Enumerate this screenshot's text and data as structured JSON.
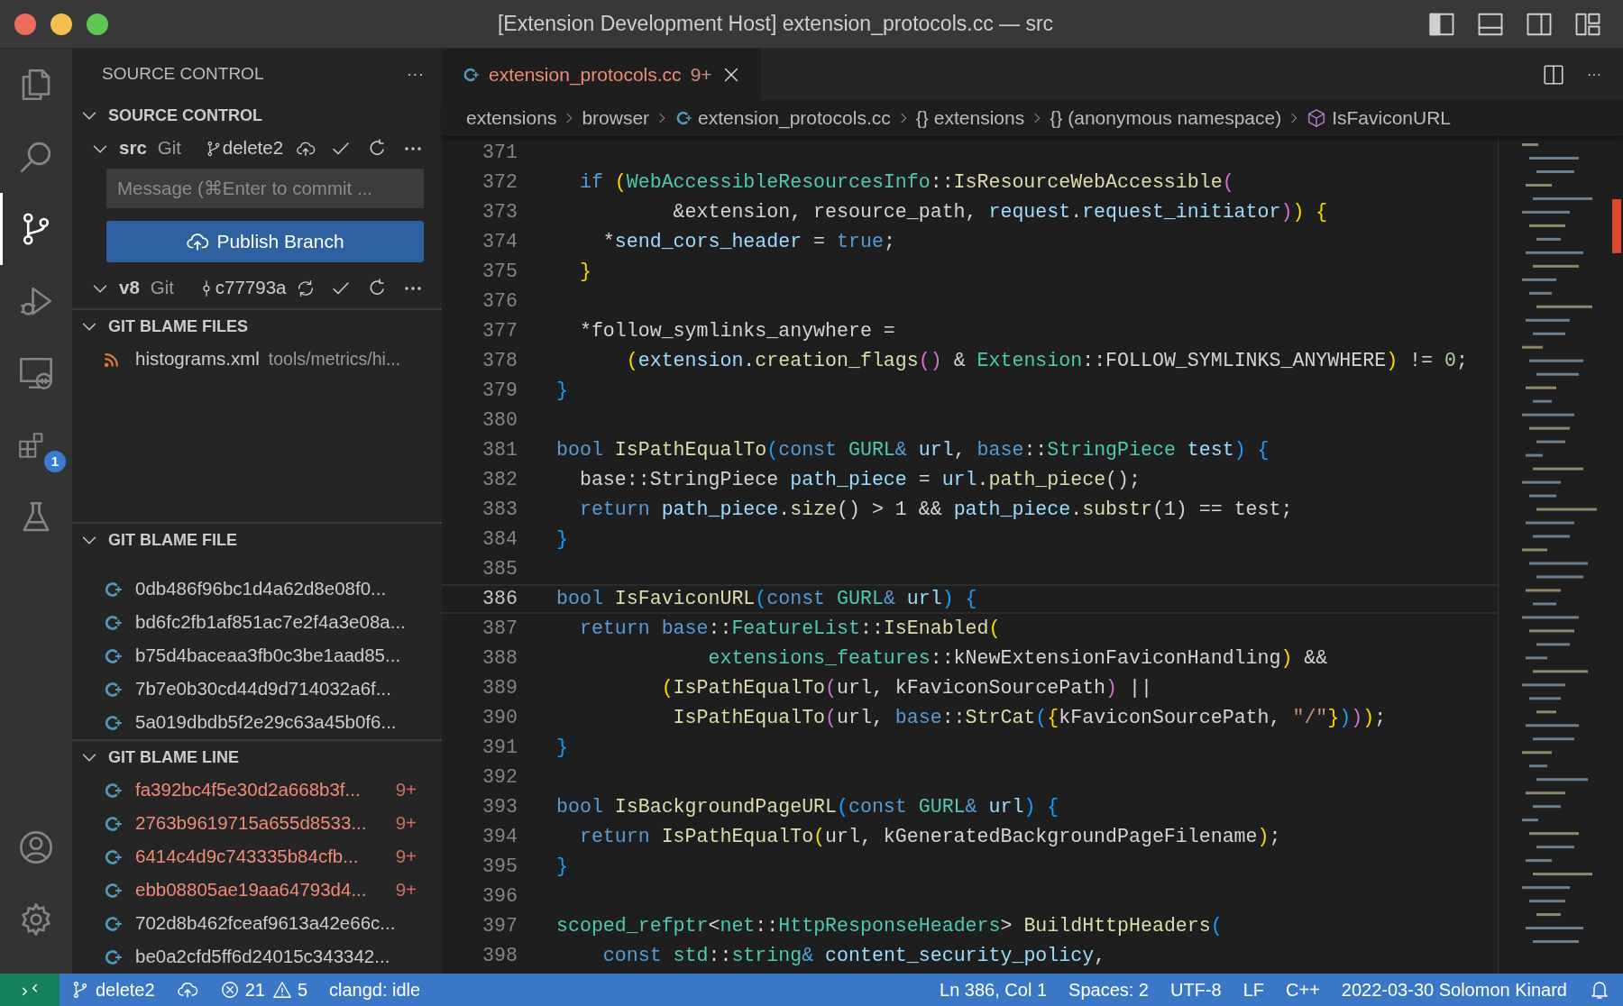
{
  "window": {
    "title": "[Extension Development Host] extension_protocols.cc — src",
    "layout_buttons": [
      {
        "kind": "sidebar"
      },
      {
        "kind": "panel"
      },
      {
        "kind": "secondary"
      },
      {
        "kind": "custom"
      }
    ]
  },
  "activity_bar": [
    {
      "kind": "explorer",
      "selected": false
    },
    {
      "kind": "search",
      "selected": false
    },
    {
      "kind": "scm",
      "selected": true
    },
    {
      "kind": "debug",
      "selected": false
    },
    {
      "kind": "remote",
      "selected": false
    },
    {
      "kind": "extensions",
      "selected": false,
      "badge": "1"
    },
    {
      "kind": "testing",
      "selected": false
    },
    {
      "kind": "accounts",
      "selected": false
    },
    {
      "kind": "settings",
      "selected": false
    }
  ],
  "sidebar": {
    "title": "SOURCE CONTROL",
    "more": "···",
    "sections": [
      {
        "kind": "repositories",
        "title": "SOURCE CONTROL",
        "expanded": true,
        "repositories": [
          {
            "name": "src",
            "provider": "Git",
            "ref": {
              "kind": "branch",
              "text": "delete2"
            },
            "sync": {
              "kind": "publish"
            },
            "expanded": true,
            "message": {
              "placeholder": "Message (⌘Enter to commit ..."
            },
            "action": "Publish Branch"
          },
          {
            "name": "v8",
            "provider": "Git",
            "ref": {
              "kind": "commit",
              "text": "c77793a"
            },
            "sync": {
              "kind": "sync"
            },
            "expanded": true
          }
        ]
      },
      {
        "kind": "files",
        "title": "GIT BLAME FILES",
        "expanded": true,
        "items": [
          {
            "name": "histograms.xml",
            "path": "tools/metrics/hi..."
          }
        ]
      },
      {
        "kind": "commits",
        "title": "GIT BLAME FILE",
        "expanded": true,
        "items": [
          {
            "hash": "0db486f96bc1d4a62d8e08f0...",
            "error": false
          },
          {
            "hash": "bd6fc2fb1af851ac7e2f4a3e08a...",
            "error": false
          },
          {
            "hash": "b75d4baceaa3fb0c3be1aad85...",
            "error": false
          },
          {
            "hash": "7b7e0b30cd44d9d714032a6f...",
            "error": false
          },
          {
            "hash": "5a019dbdb5f2e29c63a45b0f6...",
            "error": false
          }
        ]
      },
      {
        "kind": "commits",
        "title": "GIT BLAME LINE",
        "expanded": true,
        "items": [
          {
            "hash": "fa392bc4f5e30d2a668b3f...",
            "error": true,
            "problems": "9+"
          },
          {
            "hash": "2763b9619715a655d8533...",
            "error": true,
            "problems": "9+"
          },
          {
            "hash": "6414c4d9c743335b84cfb...",
            "error": true,
            "problems": "9+"
          },
          {
            "hash": "ebb08805ae19aa64793d4...",
            "error": true,
            "problems": "9+"
          },
          {
            "hash": "702d8b462fceaf9613a42e66c...",
            "error": false
          },
          {
            "hash": "be0a2cfd5ff6d24015c343342...",
            "error": false
          }
        ]
      }
    ]
  },
  "editor": {
    "tabs": [
      {
        "name": "extension_protocols.cc",
        "problems": "9+",
        "error": true,
        "selected": true
      }
    ],
    "more": "···",
    "breadcrumbs": [
      {
        "kind": "folder",
        "label": "extensions"
      },
      {
        "kind": "folder",
        "label": "browser"
      },
      {
        "kind": "file",
        "label": "extension_protocols.cc"
      },
      {
        "kind": "namespace",
        "symbol": "{}",
        "label": "extensions"
      },
      {
        "kind": "namespace",
        "symbol": "{}",
        "label": "(anonymous namespace)"
      },
      {
        "kind": "method",
        "label": "IsFaviconURL"
      }
    ],
    "lines": [
      {
        "number": "371",
        "current": false
      },
      {
        "number": "372",
        "current": false,
        "tokens": [
          {
            "kind": "keyword",
            "text": "  if"
          },
          {
            "kind": "bracket1",
            "text": " ("
          },
          {
            "kind": "type",
            "text": "WebAccessibleResourcesInfo"
          },
          {
            "kind": "plain",
            "text": "::"
          },
          {
            "kind": "function",
            "text": "IsResourceWebAccessible"
          },
          {
            "kind": "bracket2",
            "text": "("
          }
        ]
      },
      {
        "number": "373",
        "current": false,
        "tokens": [
          {
            "kind": "plain",
            "text": "          &extension, resource_path, "
          },
          {
            "kind": "variable",
            "text": "request"
          },
          {
            "kind": "plain",
            "text": "."
          },
          {
            "kind": "variable",
            "text": "request_initiator"
          },
          {
            "kind": "bracket2",
            "text": ")"
          },
          {
            "kind": "bracket1",
            "text": ")"
          },
          {
            "kind": "bracket1",
            "text": " {"
          }
        ]
      },
      {
        "number": "374",
        "current": false,
        "tokens": [
          {
            "kind": "plain",
            "text": "    *"
          },
          {
            "kind": "variable",
            "text": "send_cors_header"
          },
          {
            "kind": "plain",
            "text": " = "
          },
          {
            "kind": "keyword",
            "text": "true"
          },
          {
            "kind": "plain",
            "text": ";"
          }
        ]
      },
      {
        "number": "375",
        "current": false,
        "tokens": [
          {
            "kind": "bracket1",
            "text": "  }"
          }
        ]
      },
      {
        "number": "376",
        "current": false
      },
      {
        "number": "377",
        "current": false,
        "tokens": [
          {
            "kind": "plain",
            "text": "  *follow_symlinks_anywhere ="
          }
        ]
      },
      {
        "number": "378",
        "current": false,
        "tokens": [
          {
            "kind": "bracket1",
            "text": "      ("
          },
          {
            "kind": "variable",
            "text": "extension"
          },
          {
            "kind": "plain",
            "text": "."
          },
          {
            "kind": "function",
            "text": "creation_flags"
          },
          {
            "kind": "bracket2",
            "text": "()"
          },
          {
            "kind": "plain",
            "text": " & "
          },
          {
            "kind": "type",
            "text": "Extension"
          },
          {
            "kind": "plain",
            "text": "::FOLLOW_SYMLINKS_ANYWHERE"
          },
          {
            "kind": "bracket1",
            "text": ")"
          },
          {
            "kind": "plain",
            "text": " != "
          },
          {
            "kind": "number",
            "text": "0"
          },
          {
            "kind": "plain",
            "text": ";"
          }
        ]
      },
      {
        "number": "379",
        "current": false,
        "tokens": [
          {
            "kind": "bracket3",
            "text": "}"
          }
        ]
      },
      {
        "number": "380",
        "current": false
      },
      {
        "number": "381",
        "current": false,
        "tokens": [
          {
            "kind": "keyword",
            "text": "bool"
          },
          {
            "kind": "function",
            "text": " IsPathEqualTo"
          },
          {
            "kind": "bracket3",
            "text": "("
          },
          {
            "kind": "keyword",
            "text": "const"
          },
          {
            "kind": "type",
            "text": " GURL"
          },
          {
            "kind": "keyword",
            "text": "&"
          },
          {
            "kind": "variable",
            "text": " url"
          },
          {
            "kind": "plain",
            "text": ", "
          },
          {
            "kind": "keyword",
            "text": "base"
          },
          {
            "kind": "plain",
            "text": "::"
          },
          {
            "kind": "type",
            "text": "StringPiece"
          },
          {
            "kind": "variable",
            "text": " test"
          },
          {
            "kind": "bracket3",
            "text": ")"
          },
          {
            "kind": "bracket3",
            "text": " {"
          }
        ]
      },
      {
        "number": "382",
        "current": false,
        "tokens": [
          {
            "kind": "plain",
            "text": "  base::StringPiece "
          },
          {
            "kind": "variable",
            "text": "path_piece"
          },
          {
            "kind": "plain",
            "text": " = "
          },
          {
            "kind": "variable",
            "text": "url"
          },
          {
            "kind": "plain",
            "text": "."
          },
          {
            "kind": "function",
            "text": "path_piece"
          },
          {
            "kind": "plain",
            "text": "();"
          }
        ]
      },
      {
        "number": "383",
        "current": false,
        "tokens": [
          {
            "kind": "keyword",
            "text": "  return"
          },
          {
            "kind": "variable",
            "text": " path_piece"
          },
          {
            "kind": "plain",
            "text": "."
          },
          {
            "kind": "function",
            "text": "size"
          },
          {
            "kind": "plain",
            "text": "() > 1 && "
          },
          {
            "kind": "variable",
            "text": "path_piece"
          },
          {
            "kind": "plain",
            "text": "."
          },
          {
            "kind": "function",
            "text": "substr"
          },
          {
            "kind": "plain",
            "text": "(1) == test;"
          }
        ]
      },
      {
        "number": "384",
        "current": false,
        "tokens": [
          {
            "kind": "bracket3",
            "text": "}"
          }
        ]
      },
      {
        "number": "385",
        "current": false
      },
      {
        "number": "386",
        "current": true,
        "tokens": [
          {
            "kind": "keyword",
            "text": "bool"
          },
          {
            "kind": "function",
            "text": " IsFaviconURL"
          },
          {
            "kind": "bracket3",
            "text": "("
          },
          {
            "kind": "keyword",
            "text": "const"
          },
          {
            "kind": "type",
            "text": " GURL"
          },
          {
            "kind": "keyword",
            "text": "&"
          },
          {
            "kind": "variable",
            "text": " url"
          },
          {
            "kind": "bracket3",
            "text": ")"
          },
          {
            "kind": "bracket3",
            "text": " {"
          }
        ]
      },
      {
        "number": "387",
        "current": false,
        "tokens": [
          {
            "kind": "keyword",
            "text": "  return"
          },
          {
            "kind": "keyword",
            "text": " base"
          },
          {
            "kind": "plain",
            "text": "::"
          },
          {
            "kind": "type",
            "text": "FeatureList"
          },
          {
            "kind": "plain",
            "text": "::"
          },
          {
            "kind": "function",
            "text": "IsEnabled"
          },
          {
            "kind": "bracket1",
            "text": "("
          }
        ]
      },
      {
        "number": "388",
        "current": false,
        "tokens": [
          {
            "kind": "type",
            "text": "             extensions_features"
          },
          {
            "kind": "plain",
            "text": "::kNewExtensionFaviconHandling"
          },
          {
            "kind": "bracket1",
            "text": ")"
          },
          {
            "kind": "plain",
            "text": " &&"
          }
        ]
      },
      {
        "number": "389",
        "current": false,
        "tokens": [
          {
            "kind": "bracket1",
            "text": "         ("
          },
          {
            "kind": "function",
            "text": "IsPathEqualTo"
          },
          {
            "kind": "bracket2",
            "text": "("
          },
          {
            "kind": "plain",
            "text": "url, kFaviconSourcePath"
          },
          {
            "kind": "bracket2",
            "text": ")"
          },
          {
            "kind": "plain",
            "text": " ||"
          }
        ]
      },
      {
        "number": "390",
        "current": false,
        "tokens": [
          {
            "kind": "function",
            "text": "          IsPathEqualTo"
          },
          {
            "kind": "bracket2",
            "text": "("
          },
          {
            "kind": "plain",
            "text": "url, "
          },
          {
            "kind": "keyword",
            "text": "base"
          },
          {
            "kind": "plain",
            "text": "::"
          },
          {
            "kind": "function",
            "text": "StrCat"
          },
          {
            "kind": "bracket3",
            "text": "("
          },
          {
            "kind": "bracket1",
            "text": "{"
          },
          {
            "kind": "plain",
            "text": "kFaviconSourcePath, "
          },
          {
            "kind": "string",
            "text": "\"/\""
          },
          {
            "kind": "bracket1",
            "text": "}"
          },
          {
            "kind": "bracket3",
            "text": ")"
          },
          {
            "kind": "bracket2",
            "text": ")"
          },
          {
            "kind": "bracket1",
            "text": ")"
          },
          {
            "kind": "plain",
            "text": ";"
          }
        ]
      },
      {
        "number": "391",
        "current": false,
        "tokens": [
          {
            "kind": "bracket3",
            "text": "}"
          }
        ]
      },
      {
        "number": "392",
        "current": false
      },
      {
        "number": "393",
        "current": false,
        "tokens": [
          {
            "kind": "keyword",
            "text": "bool"
          },
          {
            "kind": "function",
            "text": " IsBackgroundPageURL"
          },
          {
            "kind": "bracket3",
            "text": "("
          },
          {
            "kind": "keyword",
            "text": "const"
          },
          {
            "kind": "type",
            "text": " GURL"
          },
          {
            "kind": "keyword",
            "text": "&"
          },
          {
            "kind": "variable",
            "text": " url"
          },
          {
            "kind": "bracket3",
            "text": ")"
          },
          {
            "kind": "bracket3",
            "text": " {"
          }
        ]
      },
      {
        "number": "394",
        "current": false,
        "tokens": [
          {
            "kind": "keyword",
            "text": "  return"
          },
          {
            "kind": "function",
            "text": " IsPathEqualTo"
          },
          {
            "kind": "bracket1",
            "text": "("
          },
          {
            "kind": "plain",
            "text": "url, kGeneratedBackgroundPageFilename"
          },
          {
            "kind": "bracket1",
            "text": ")"
          },
          {
            "kind": "plain",
            "text": ";"
          }
        ]
      },
      {
        "number": "395",
        "current": false,
        "tokens": [
          {
            "kind": "bracket3",
            "text": "}"
          }
        ]
      },
      {
        "number": "396",
        "current": false
      },
      {
        "number": "397",
        "current": false,
        "tokens": [
          {
            "kind": "type",
            "text": "scoped_refptr"
          },
          {
            "kind": "plain",
            "text": "<"
          },
          {
            "kind": "type",
            "text": "net"
          },
          {
            "kind": "plain",
            "text": "::"
          },
          {
            "kind": "type",
            "text": "HttpResponseHeaders"
          },
          {
            "kind": "plain",
            "text": ">"
          },
          {
            "kind": "function",
            "text": " BuildHttpHeaders"
          },
          {
            "kind": "bracket3",
            "text": "("
          }
        ]
      },
      {
        "number": "398",
        "current": false,
        "tokens": [
          {
            "kind": "keyword",
            "text": "    const"
          },
          {
            "kind": "type",
            "text": " std"
          },
          {
            "kind": "plain",
            "text": "::"
          },
          {
            "kind": "type",
            "text": "string"
          },
          {
            "kind": "keyword",
            "text": "&"
          },
          {
            "kind": "variable",
            "text": " content_security_policy"
          },
          {
            "kind": "plain",
            "text": ","
          }
        ]
      }
    ]
  },
  "status_bar": {
    "left": [
      {
        "kind": "remote"
      },
      {
        "kind": "branch",
        "text": "delete2"
      },
      {
        "kind": "publish"
      },
      {
        "kind": "errors",
        "text": "21"
      },
      {
        "kind": "warnings",
        "text": "5"
      },
      {
        "kind": "text",
        "text": "clangd: idle"
      }
    ],
    "right": [
      {
        "kind": "text",
        "text": "Ln 386, Col 1"
      },
      {
        "kind": "text",
        "text": "Spaces: 2"
      },
      {
        "kind": "text",
        "text": "UTF-8"
      },
      {
        "kind": "text",
        "text": "LF"
      },
      {
        "kind": "text",
        "text": "C++"
      },
      {
        "kind": "text",
        "text": "2022-03-30 Solomon Kinard"
      },
      {
        "kind": "bell"
      }
    ]
  }
}
